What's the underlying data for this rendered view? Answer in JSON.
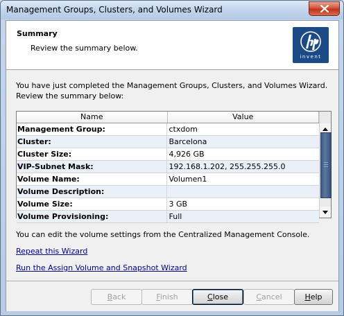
{
  "window": {
    "title": "Management Groups, Clusters, and Volumes Wizard"
  },
  "header": {
    "title": "Summary",
    "subtitle": "Review the summary below.",
    "logo_text": "invent"
  },
  "intro_text": "You have just completed the Management Groups, Clusters, and Volumes Wizard. Review the summary below:",
  "table": {
    "columns": [
      "Name",
      "Value"
    ],
    "rows": [
      {
        "name": "Management Group:",
        "value": "ctxdom"
      },
      {
        "name": "Cluster:",
        "value": "Barcelona"
      },
      {
        "name": "Cluster Size:",
        "value": "4,926 GB"
      },
      {
        "name": "VIP-Subnet Mask:",
        "value": "192.168.1.202, 255.255.255.0"
      },
      {
        "name": "Volume Name:",
        "value": "Volumen1"
      },
      {
        "name": "Volume Description:",
        "value": ""
      },
      {
        "name": "Volume Size:",
        "value": "3 GB"
      },
      {
        "name": "Volume Provisioning:",
        "value": "Full"
      }
    ]
  },
  "edit_note": "You can edit the volume settings from the Centralized Management Console.",
  "links": {
    "repeat": "Repeat this Wizard",
    "assign": "Run the Assign Volume and Snapshot Wizard"
  },
  "buttons": {
    "back": {
      "first": "B",
      "rest": "ack"
    },
    "finish": {
      "first": "F",
      "rest": "inish"
    },
    "close": {
      "first": "C",
      "rest": "lose"
    },
    "cancel": {
      "first": "C",
      "rest": "ancel"
    },
    "help": {
      "first": "H",
      "rest": "elp"
    }
  },
  "colors": {
    "link": "#00008b",
    "logo_bg": "#1b4a86",
    "close_button": "#c0331a"
  }
}
